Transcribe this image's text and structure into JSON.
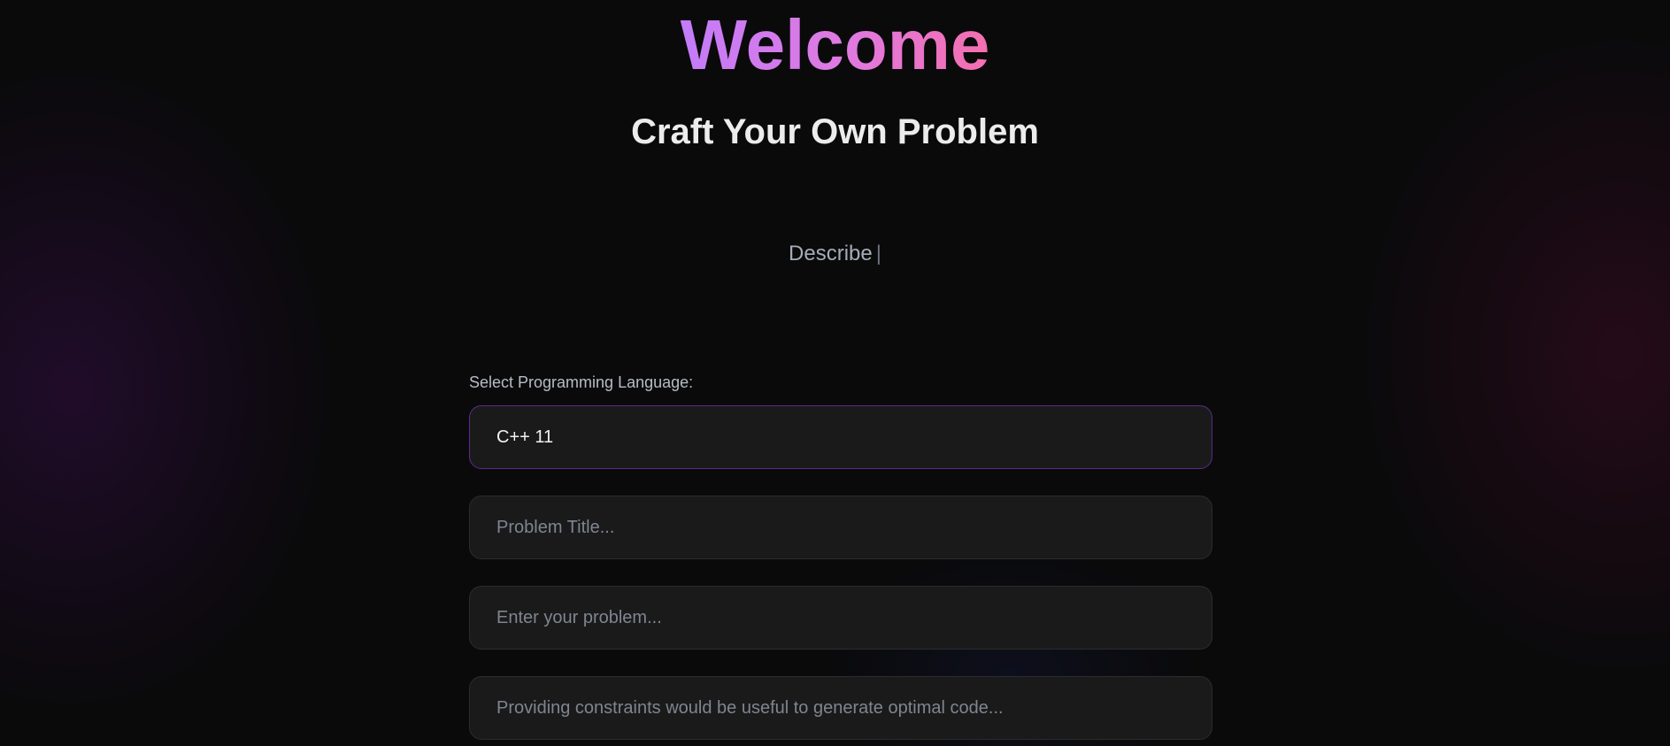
{
  "header": {
    "welcome": "Welcome",
    "subtitle": "Craft Your Own Problem",
    "typing_text": "Describe",
    "typing_cursor": "|"
  },
  "form": {
    "language_label": "Select Programming Language:",
    "language_selected": "C++ 11",
    "title_placeholder": "Problem Title...",
    "problem_placeholder": "Enter your problem...",
    "constraints_placeholder": "Providing constraints would be useful to generate optimal code..."
  },
  "colors": {
    "background": "#0a0a0b",
    "gradient_start": "#c37cf8",
    "gradient_end": "#f56fae",
    "field_bg": "#1a1a1b",
    "select_border": "#5b2a8f"
  }
}
